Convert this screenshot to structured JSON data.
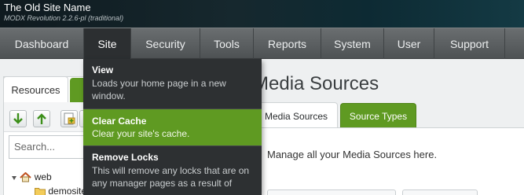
{
  "header": {
    "site_name": "The Old Site Name",
    "subtitle": "MODX Revolution 2.2.6-pl (traditional)"
  },
  "nav": {
    "items": [
      "Dashboard",
      "Site",
      "Security",
      "Tools",
      "Reports",
      "System",
      "User",
      "Support"
    ],
    "active": "Site"
  },
  "site_menu": [
    {
      "title": "View",
      "description": "Loads your home page in a new window."
    },
    {
      "title": "Clear Cache",
      "description": "Clear your site's cache."
    },
    {
      "title": "Remove Locks",
      "description": "This will remove any locks that are on any manager pages as a result of"
    }
  ],
  "left_panel": {
    "tab_resources": "Resources",
    "search_placeholder": "Search...",
    "tree_root": "web",
    "tree_child": "demosite"
  },
  "main": {
    "title": "Media Sources",
    "tabs": [
      "Media Sources",
      "Source Types"
    ],
    "description": "Manage all your Media Sources here."
  },
  "colors": {
    "accent_green": "#5f9a22",
    "nav_gray": "#5a5e60",
    "menu_dark": "#2d3032"
  }
}
